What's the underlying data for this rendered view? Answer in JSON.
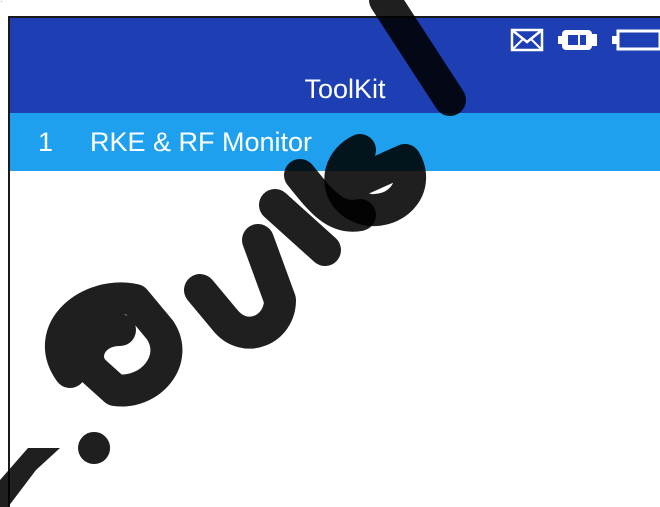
{
  "header": {
    "title": "ToolKit",
    "status_icons": [
      "mail-icon",
      "vehicle-connection-icon",
      "battery-icon"
    ]
  },
  "menu": {
    "items": [
      {
        "index": "1",
        "label": "RKE & RF Monitor"
      }
    ]
  },
  "colors": {
    "header_bg": "#1d3fb3",
    "selected_item_bg": "#1ea0ee",
    "text": "#ffffff",
    "watermark": "#000000"
  }
}
